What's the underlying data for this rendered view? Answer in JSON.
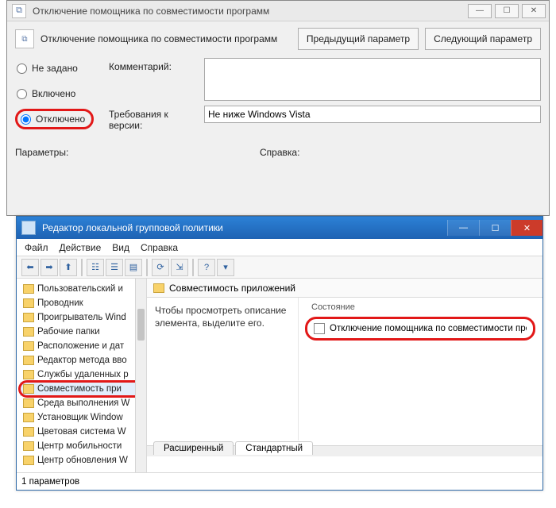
{
  "gpo_dialog": {
    "title": "Отключение помощника по совместимости программ",
    "header": "Отключение помощника по совместимости программ",
    "prev_btn": "Предыдущий параметр",
    "next_btn": "Следующий параметр",
    "radio_not_set": "Не задано",
    "radio_enabled": "Включено",
    "radio_disabled": "Отключено",
    "comment_label": "Комментарий:",
    "comment_value": "",
    "req_label": "Требования к версии:",
    "req_value": "Не ниже Windows Vista",
    "params_label": "Параметры:",
    "help_label": "Справка:"
  },
  "gpedit": {
    "title": "Редактор локальной групповой политики",
    "menu": {
      "file": "Файл",
      "action": "Действие",
      "view": "Вид",
      "help": "Справка"
    },
    "toolbar_icons": [
      "back-icon",
      "forward-icon",
      "up-icon",
      "folder-tree-icon",
      "list-icon",
      "details-icon",
      "refresh-icon",
      "export-icon",
      "help-icon",
      "filter-icon"
    ],
    "tree": [
      "Пользовательский и",
      "Проводник",
      "Проигрыватель Wind",
      "Рабочие папки",
      "Расположение и дат",
      "Редактор метода вво",
      "Службы удаленных р",
      "Совместимость при",
      "Среда выполнения W",
      "Установщик Window",
      "Цветовая система W",
      "Центр мобильности",
      "Центр обновления W"
    ],
    "selected_index": 7,
    "detail_header": "Совместимость приложений",
    "desc": "Чтобы просмотреть описание элемента, выделите его.",
    "state_col": "Состояние",
    "state_item": "Отключение помощника по совместимости програ",
    "tab_ext": "Расширенный",
    "tab_std": "Стандартный",
    "status": "1 параметров"
  }
}
